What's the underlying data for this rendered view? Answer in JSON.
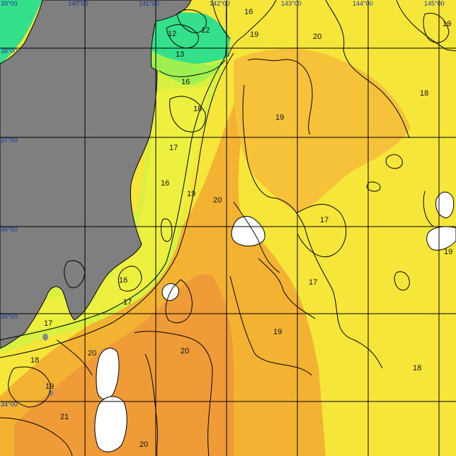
{
  "map": {
    "colors": {
      "land": "#7f7f7f",
      "sst_cold": "#2fe08a",
      "sst_mid": "#c8f040",
      "sst_yellow": "#f6e63a",
      "sst_warm": "#f4b030",
      "sst_hot": "#ef9a38",
      "cloud_mask": "#ffffff",
      "grid": "#000000",
      "contour": "#000000",
      "coord_text": "#1a3aa0"
    },
    "lon_labels": [
      "139°00",
      "140°00",
      "141°00",
      "142°00",
      "143°00",
      "144°00",
      "145°00"
    ],
    "lat_labels": [
      "38°00",
      "37°00",
      "36°00",
      "35°00",
      "34°00"
    ],
    "top_left_label": "39°00",
    "isotherm_labels": [
      {
        "text": "16"
      },
      {
        "text": "12"
      },
      {
        "text": "12"
      },
      {
        "text": "19"
      },
      {
        "text": "20"
      },
      {
        "text": "19"
      },
      {
        "text": "13"
      },
      {
        "text": "16"
      },
      {
        "text": "18"
      },
      {
        "text": "19"
      },
      {
        "text": "18"
      },
      {
        "text": "17"
      },
      {
        "text": "16"
      },
      {
        "text": "19"
      },
      {
        "text": "20"
      },
      {
        "text": "17"
      },
      {
        "text": "19"
      },
      {
        "text": "16"
      },
      {
        "text": "17"
      },
      {
        "text": "17"
      },
      {
        "text": "17"
      },
      {
        "text": "19"
      },
      {
        "text": "20"
      },
      {
        "text": "20"
      },
      {
        "text": "18"
      },
      {
        "text": "18"
      },
      {
        "text": "19"
      },
      {
        "text": "21"
      },
      {
        "text": "20"
      }
    ]
  }
}
